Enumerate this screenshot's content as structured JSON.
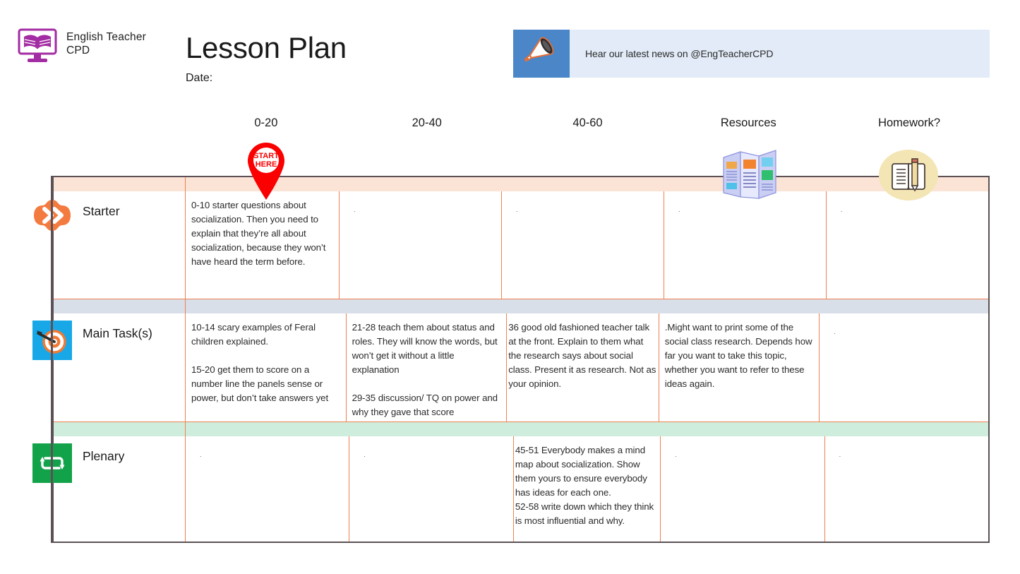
{
  "brand": {
    "name": "English Teacher\nCPD",
    "logo_icon": "monitor-book-icon",
    "logo_color": "#a32ba3"
  },
  "header": {
    "title": "Lesson Plan",
    "date_label": "Date:",
    "date_value": ""
  },
  "news_banner": {
    "icon": "megaphone-icon",
    "icon_box_color": "#4a86c8",
    "background_color": "#e2ebf7",
    "text": "Hear our latest news on @EngTeacherCPD"
  },
  "decorations": {
    "start_pin": {
      "icon": "map-pin-icon",
      "line1": "START",
      "line2": "HERE",
      "color": "#fa0000"
    },
    "resources_icon": "brochure-icon",
    "homework_icon": "notebook-pencil-icon"
  },
  "table": {
    "columns": [
      "0-20",
      "20-40",
      "40-60",
      "Resources",
      "Homework?"
    ],
    "border_color": "#5c5156",
    "grid_color": "#f08050",
    "rows": [
      {
        "label": "Starter",
        "icon": "double-chevron-icon",
        "icon_color": "#f47b3f",
        "band_color": "#fbe3d6",
        "cells": [
          "0-10 starter questions about socialization. Then you need to explain that they’re all about socialization, because they won’t have heard the term before.",
          ".",
          ".",
          ".",
          "."
        ]
      },
      {
        "label": "Main Task(s)",
        "icon": "target-dart-icon",
        "icon_color": "#18a8e8",
        "band_color": "#d9dfe8",
        "cells": [
          "10-14  scary examples of Feral children explained.\n\n15-20 get them to score on a number line the panels sense or power, but don’t take answers yet",
          "21-28 teach them about status and roles. They will know the words, but won’t get it without a little explanation\n\n29-35 discussion/ TQ on power and why they gave that score",
          "36 good old fashioned teacher talk at the front. Explain to them what the research says about social class. Present it as research. Not as your opinion.",
          ".Might want to print some of the social class research. Depends how far you want to take this topic, whether you want to refer to these ideas again.",
          "."
        ]
      },
      {
        "label": "Plenary",
        "icon": "loop-repeat-icon",
        "icon_color": "#12a34a",
        "band_color": "#cfeddc",
        "cells": [
          ".",
          ".",
          "45-51 Everybody makes a mind map about socialization. Show them yours to ensure everybody has ideas for each one.\n52-58 write down which they think is most influential and why.",
          ".",
          "."
        ]
      }
    ]
  }
}
